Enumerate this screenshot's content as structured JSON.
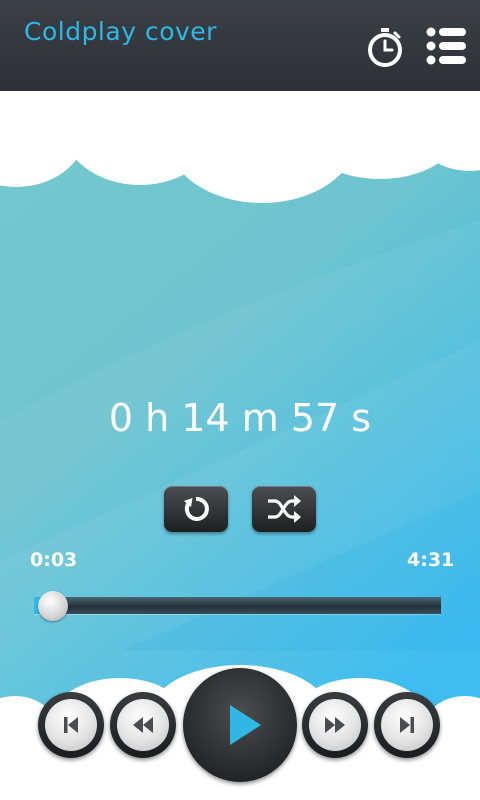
{
  "app": {
    "title": "Coldplay cover"
  },
  "colors": {
    "accent": "#2fb8e6",
    "topbar": "#33373c",
    "sky_top": "#71c5cc",
    "sky_bottom": "#29b6ee"
  },
  "icons": {
    "timer": "stopwatch-icon",
    "menu": "list-menu-icon",
    "repeat": "repeat-icon",
    "shuffle": "shuffle-icon",
    "prev": "skip-previous-icon",
    "rewind": "rewind-icon",
    "play": "play-icon",
    "forward": "fast-forward-icon",
    "next": "skip-next-icon"
  },
  "player": {
    "elapsed": "0 h 14 m 57 s",
    "current_time": "0:03",
    "total_time": "4:31",
    "progress_fraction": 0.011
  }
}
